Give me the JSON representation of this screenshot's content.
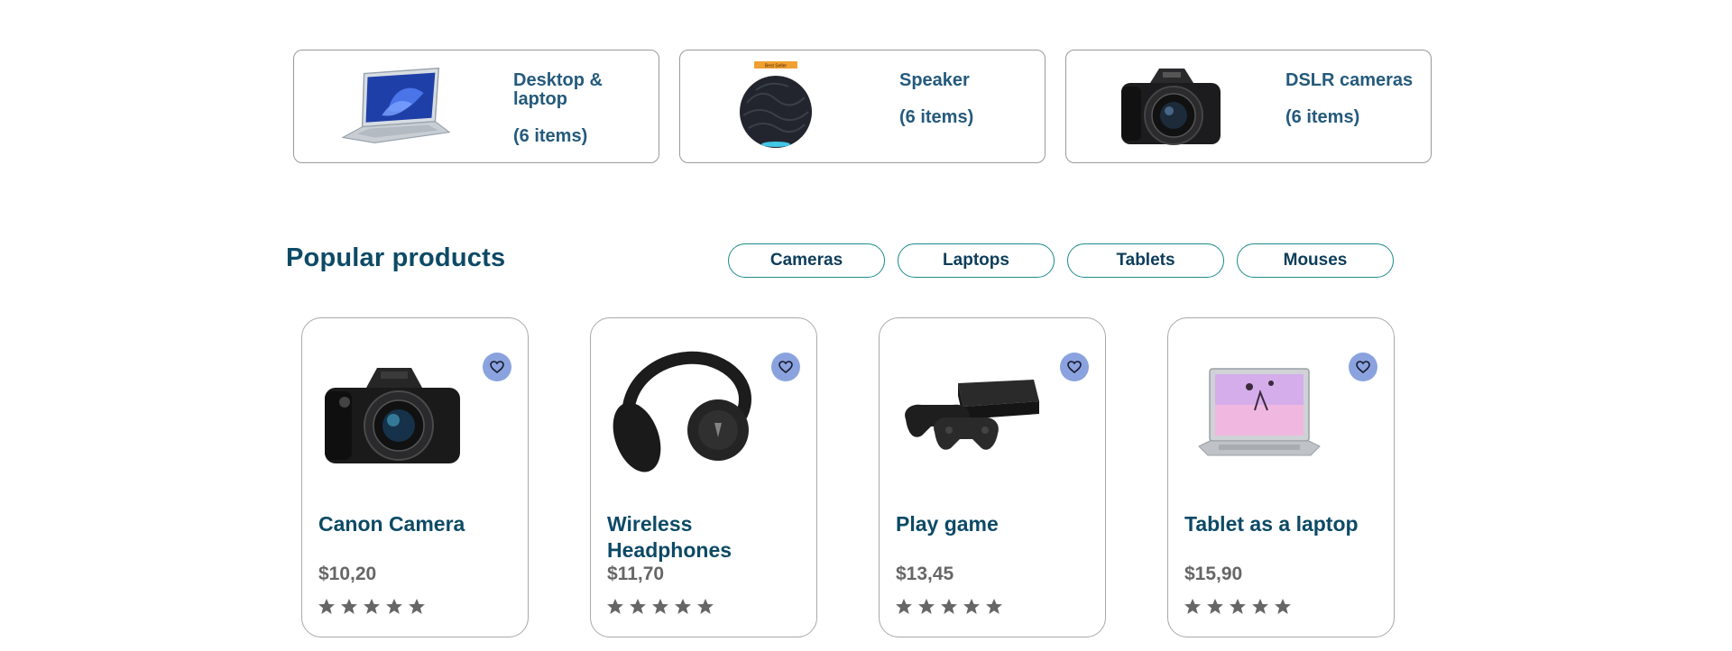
{
  "categories": [
    {
      "title": "Desktop & laptop",
      "count": "(6 items)",
      "icon": "laptop-image"
    },
    {
      "title": "Speaker",
      "count": "(6 items)",
      "icon": "smart-speaker-image",
      "badge": "Best Seller"
    },
    {
      "title": "DSLR cameras",
      "count": "(6 items)",
      "icon": "dslr-camera-image"
    }
  ],
  "popular": {
    "title": "Popular products",
    "filters": [
      "Cameras",
      "Laptops",
      "Tablets",
      "Mouses"
    ]
  },
  "products": [
    {
      "name": "Canon Camera",
      "price": "$10,20",
      "rating": 5,
      "icon": "camera-image"
    },
    {
      "name": "Wireless Headphones",
      "price": "$11,70",
      "rating": 5,
      "icon": "headphones-image"
    },
    {
      "name": "Play game",
      "price": "$13,45",
      "rating": 5,
      "icon": "game-console-image"
    },
    {
      "name": "Tablet as a laptop",
      "price": "$15,90",
      "rating": 5,
      "icon": "laptop-image"
    }
  ],
  "colors": {
    "accent_blue": "#245a7c",
    "title_dark": "#0d4a66",
    "filter_border": "#1d8a8a",
    "fav_bg": "#8aa3df",
    "star_gray": "#666666"
  }
}
